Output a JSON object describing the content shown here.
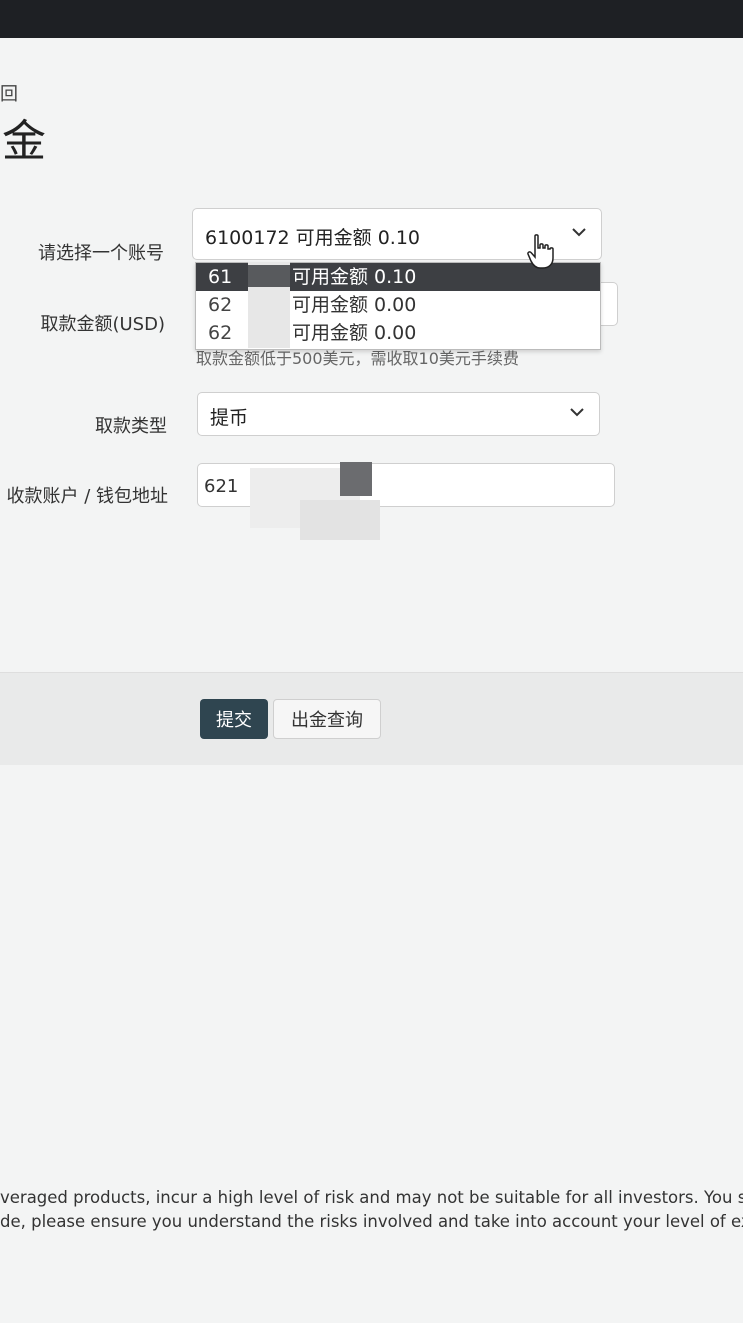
{
  "header": {
    "back_text": "回",
    "title": "金"
  },
  "form": {
    "account_label": "请选择一个账号",
    "account_selected": "6100172 可用金额 0.10",
    "account_options": [
      {
        "code": "61",
        "amount": "可用金额 0.10"
      },
      {
        "code": "62",
        "amount": "可用金额 0.00"
      },
      {
        "code": "62",
        "amount": "可用金额 0.00"
      }
    ],
    "amount_label": "取款金额(USD)",
    "amount_note": "取款金额低于500美元，需收取10美元手续费",
    "type_label": "取款类型",
    "type_value": "提币",
    "wallet_label": "收款账户 / 钱包地址",
    "wallet_value": "621"
  },
  "actions": {
    "submit_label": "提交",
    "query_label": "出金查询"
  },
  "disclaimer": {
    "line1": "veraged products, incur a high level of risk and may not be suitable for all investors. You sh",
    "line2": "de, please ensure you understand the risks involved and take into account your level of ex"
  },
  "colors": {
    "submit_bg": "#2f4550",
    "selected_option_bg": "#3d3f43"
  }
}
